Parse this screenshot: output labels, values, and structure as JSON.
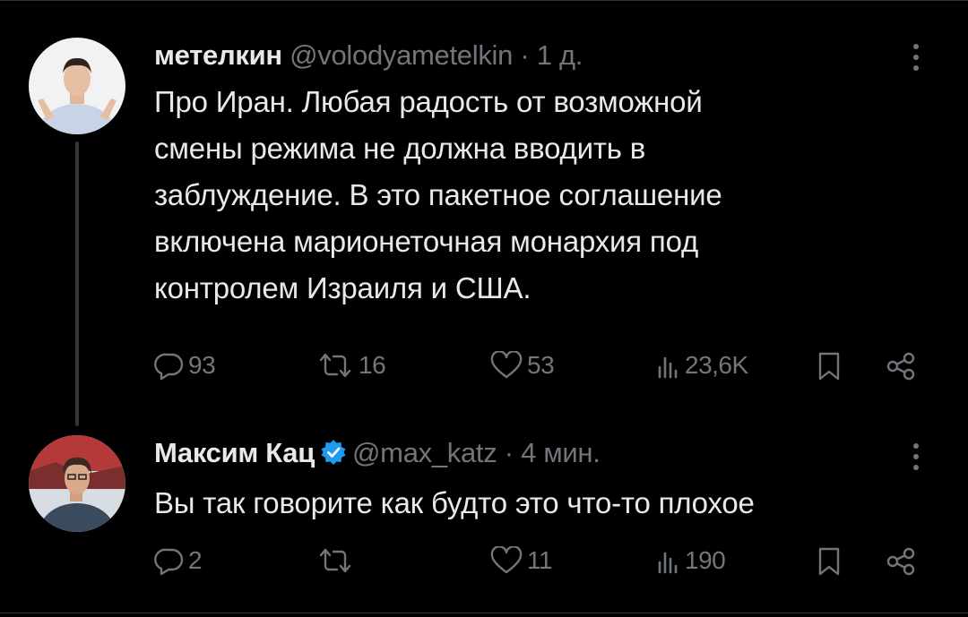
{
  "tweets": [
    {
      "name": "метелкин",
      "handle": "@volodyametelkin",
      "separator": "·",
      "time": "1 д.",
      "verified": false,
      "text_lines": [
        "Про Иран. Любая радость от возможной",
        "смены режима не должна вводить в",
        "заблуждение. В это пакетное соглашение",
        "включена марионеточная монархия под",
        "контролем Израиля и США."
      ],
      "replies": "93",
      "retweets": "16",
      "likes": "53",
      "views": "23,6K"
    },
    {
      "name": "Максим Кац",
      "handle": "@max_katz",
      "separator": "·",
      "time": "4 мин.",
      "verified": true,
      "text_lines": [
        "Вы так говорите как будто это что-то плохое"
      ],
      "replies": "2",
      "retweets": "",
      "likes": "11",
      "views": "190"
    }
  ],
  "colors": {
    "background": "#000000",
    "text": "#e7e9ea",
    "muted": "#71767b",
    "verified_badge": "#1d9bf0",
    "thread_line": "#333639"
  },
  "icons": {
    "reply": "reply-icon",
    "retweet": "retweet-icon",
    "like": "like-icon",
    "views": "views-icon",
    "bookmark": "bookmark-icon",
    "share": "share-icon",
    "more": "more-icon"
  }
}
